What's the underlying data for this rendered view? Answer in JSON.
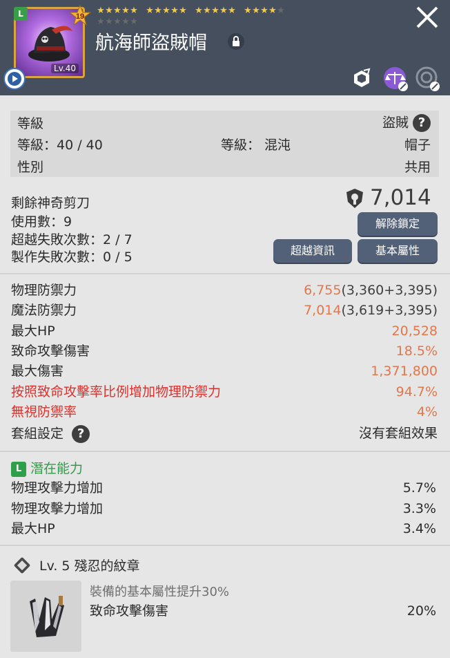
{
  "header": {
    "item_name": "航海師盜賊帽",
    "grade_badge": "L",
    "star_force_badge": "19",
    "item_level_tag": "Lv.40",
    "stars_row1": [
      1,
      1,
      1,
      1,
      1,
      1,
      1,
      1,
      1,
      1,
      1,
      1,
      1,
      1,
      1,
      1,
      1,
      1,
      1,
      0
    ],
    "stars_row2": [
      0,
      0,
      0,
      0,
      0
    ],
    "star_filled_color": "#f2c94c",
    "star_empty_color": "#6a6a6a",
    "header_bg_color": "#454f5e",
    "icons": [
      "play-icon",
      "lock-icon",
      "close-icon",
      "transfer-icon",
      "balance-icon",
      "seal-icon"
    ]
  },
  "info": {
    "level_label": "等級",
    "job": "盜賊",
    "level_value": "等級：40 / 40",
    "grade_value": "等級： 混沌",
    "category": "帽子",
    "gender_label": "性別",
    "gender_value": "共用"
  },
  "scissors": {
    "remaining_label": "剩餘神奇剪刀",
    "used": "使用數：9",
    "transcend_fail": "超越失敗次數：2 / 7",
    "craft_fail": "製作失敗次數：0 / 5",
    "combat_power": "7,014",
    "unlock_button": "解除鎖定",
    "transcend_info_button": "超越資訊",
    "base_stats_button": "基本屬性",
    "button_color": "#526178"
  },
  "stats": [
    {
      "label": "物理防禦力",
      "value_main": "6,755",
      "value_detail": "(3,360+3,395)",
      "label_class": "",
      "value_class": "orange"
    },
    {
      "label": "魔法防禦力",
      "value_main": "7,014",
      "value_detail": "(3,619+3,395)",
      "label_class": "",
      "value_class": "orange"
    },
    {
      "label": "最大HP",
      "value_main": "20,528",
      "value_detail": "",
      "label_class": "",
      "value_class": "orange"
    },
    {
      "label": "致命攻擊傷害",
      "value_main": "18.5%",
      "value_detail": "",
      "label_class": "",
      "value_class": "orange"
    },
    {
      "label": "最大傷害",
      "value_main": "1,371,800",
      "value_detail": "",
      "label_class": "",
      "value_class": "orange"
    },
    {
      "label": "按照致命攻擊率比例增加物理防禦力",
      "value_main": "94.7%",
      "value_detail": "",
      "label_class": "red",
      "value_class": "orange"
    },
    {
      "label": "無視防禦率",
      "value_main": "4%",
      "value_detail": "",
      "label_class": "red",
      "value_class": "orange"
    }
  ],
  "set": {
    "label": "套組設定",
    "value": "沒有套組效果"
  },
  "potential": {
    "badge": "L",
    "title": "潛在能力",
    "lines": [
      {
        "label": "物理攻擊力增加",
        "value": "5.7%"
      },
      {
        "label": "物理攻擊力增加",
        "value": "3.3%"
      },
      {
        "label": "最大HP",
        "value": "3.4%"
      }
    ]
  },
  "emblem": {
    "title": "Lv. 5 殘忍的紋章",
    "desc": "裝備的基本屬性提升30%",
    "stat_label": "致命攻擊傷害",
    "stat_value": "20%"
  },
  "colors": {
    "accent_orange": "#e1774a",
    "accent_red": "#e0302b",
    "potential_green": "#2e9e46",
    "page_bg": "#e6e6e6"
  }
}
